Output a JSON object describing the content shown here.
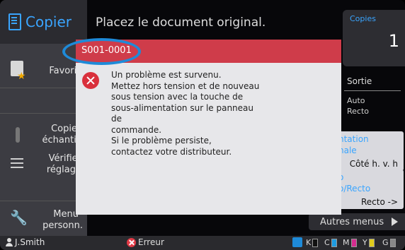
{
  "app": {
    "title": "Copier"
  },
  "top": {
    "message": "Placez le document original."
  },
  "copies": {
    "label": "Copies",
    "value": "1"
  },
  "sidebar": {
    "items": [
      {
        "label": "Favoris"
      },
      {
        "label_line1": "Copie",
        "label_line2": "échantillo"
      },
      {
        "label_line1": "Vérifier",
        "label_line2": "réglage"
      },
      {
        "label_line1": "Menu",
        "label_line2": "personn."
      }
    ]
  },
  "right_panel": {
    "sortie": "Sortie",
    "auto": "Auto",
    "recto": "Recto",
    "orientation": {
      "line1": "ntation",
      "line2": "nale",
      "value": "Côté h. v. h"
    },
    "duplex": {
      "line1": "o",
      "line2": "o/Recto",
      "value": "Recto ->"
    },
    "other_menus": "Autres menus"
  },
  "dialog": {
    "code": "S001-0001",
    "lines": [
      "Un problème est survenu.",
      "Mettez hors tension et de nouveau",
      "sous tension avec la touche de",
      "sous-alimentation sur le panneau",
      "de",
      "commande.",
      "Si le problème persiste,",
      "contactez votre distributeur."
    ]
  },
  "status": {
    "user": "J.Smith",
    "error": "Erreur",
    "toner": [
      {
        "label": "K",
        "color": "#111111"
      },
      {
        "label": "C",
        "color": "#1e9be0"
      },
      {
        "label": "M",
        "color": "#d42c8f"
      },
      {
        "label": "Y",
        "color": "#e0cc1c"
      },
      {
        "label": "G",
        "color": "#888888"
      }
    ]
  },
  "colors": {
    "accent": "#3aa5ff",
    "error": "#cf3c4a",
    "highlight": "#1e8ad8"
  }
}
